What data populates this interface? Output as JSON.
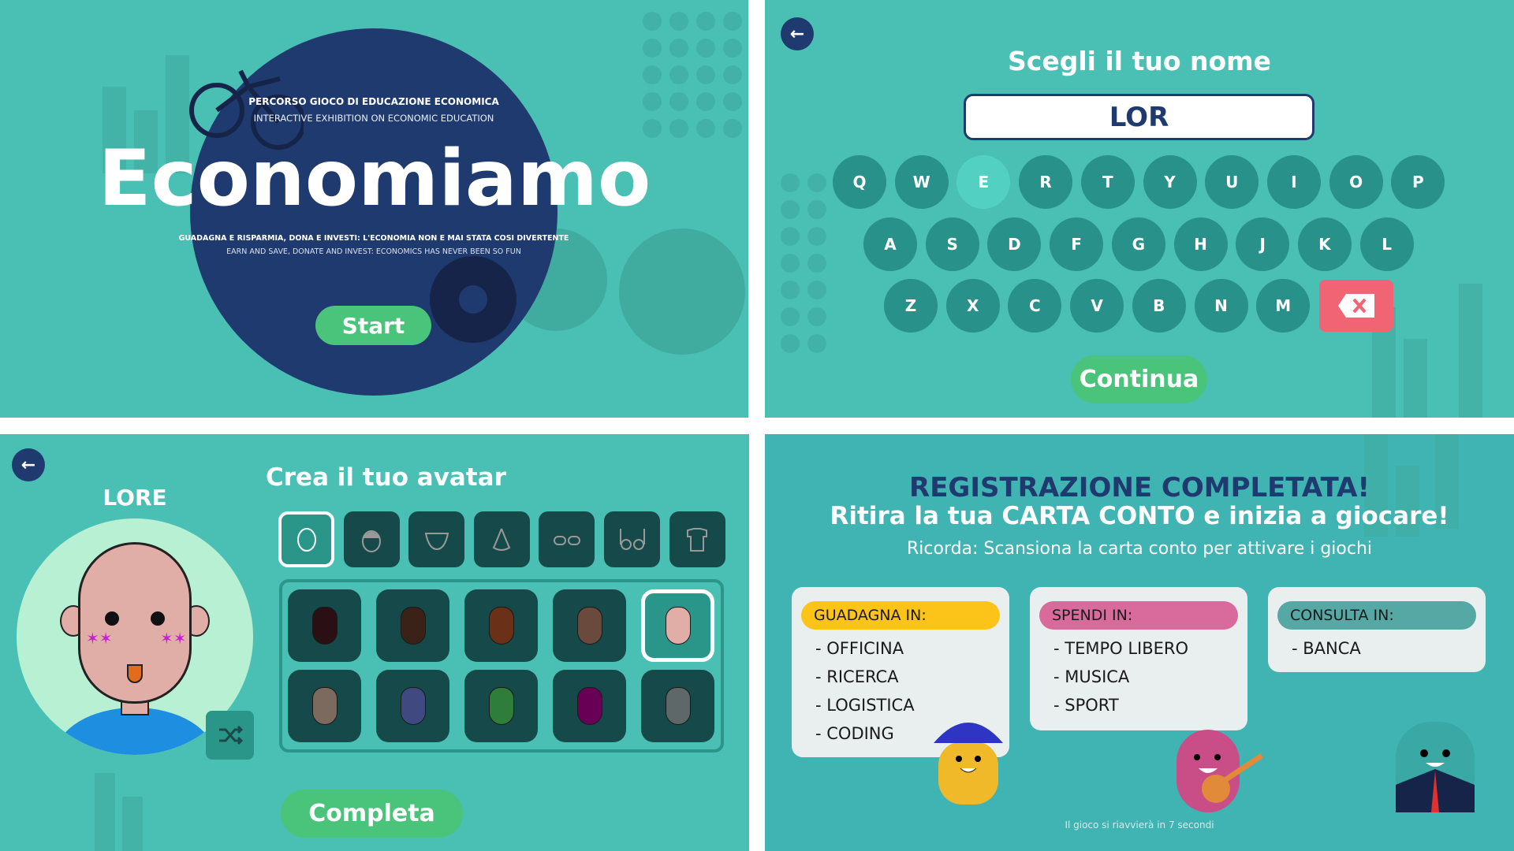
{
  "colors": {
    "teal": "#4abfb4",
    "key": "#27918a",
    "navy": "#1f3a6e",
    "green": "#4ac47a",
    "delete": "#f06474",
    "tile": "#16494a"
  },
  "intro": {
    "subtitle_it": "PERCORSO GIOCO DI EDUCAZIONE ECONOMICA",
    "subtitle_en": "INTERACTIVE EXHIBITION ON ECONOMIC EDUCATION",
    "title": "Economiamo",
    "tagline_it": "GUADAGNA E RISPARMIA, DONA E INVESTI: L'ECONOMIA NON E MAI STATA COSI DIVERTENTE",
    "tagline_en": "EARN AND SAVE, DONATE AND INVEST: ECONOMICS HAS NEVER BEEN SO FUN",
    "start_label": "Start"
  },
  "name": {
    "back_icon": "arrow-left",
    "title": "Scegli il tuo nome",
    "value": "LOR",
    "rows": [
      [
        "Q",
        "W",
        "E",
        "R",
        "T",
        "Y",
        "U",
        "I",
        "O",
        "P"
      ],
      [
        "A",
        "S",
        "D",
        "F",
        "G",
        "H",
        "J",
        "K",
        "L"
      ],
      [
        "Z",
        "X",
        "C",
        "V",
        "B",
        "N",
        "M"
      ]
    ],
    "highlighted_key": "E",
    "delete_icon": "backspace",
    "continue_label": "Continua"
  },
  "avatar": {
    "back_icon": "arrow-left",
    "name": "LORE",
    "title": "Crea il tuo avatar",
    "tabs": [
      "face",
      "hair",
      "mouth",
      "nose",
      "eyes",
      "glasses",
      "shirt"
    ],
    "selected_tab": "face",
    "skin_tones": [
      "#2a0f14",
      "#3b2218",
      "#6b3018",
      "#6b4a3e",
      "#e0aea6",
      "#7d6a5e",
      "#414a80",
      "#2e7d3a",
      "#680056",
      "#5e6868"
    ],
    "selected_skin": 4,
    "shuffle_icon": "shuffle",
    "complete_label": "Completa"
  },
  "done": {
    "title": "REGISTRAZIONE COMPLETATA!",
    "subtitle": "Ritira la tua CARTA CONTO e inizia a giocare!",
    "note": "Ricorda: Scansiona la carta conto per attivare i giochi",
    "cards": [
      {
        "label": "GUADAGNA IN:",
        "color": "#fcc419",
        "items": [
          "- OFFICINA",
          "- RICERCA",
          "- LOGISTICA",
          "- CODING"
        ]
      },
      {
        "label": "SPENDI IN:",
        "color": "#d96a9c",
        "items": [
          "- TEMPO LIBERO",
          "- MUSICA",
          "- SPORT"
        ]
      },
      {
        "label": "CONSULTA IN:",
        "color": "#56a8a4",
        "items": [
          "- BANCA"
        ]
      }
    ],
    "footer": "Il gioco si riavvierà in 7 secondi"
  }
}
